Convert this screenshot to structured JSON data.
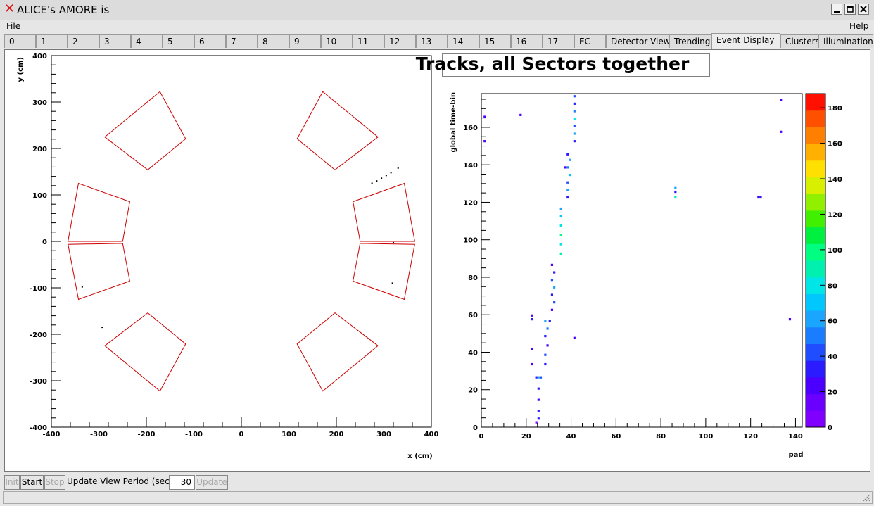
{
  "window": {
    "title": "ALICE's AMORE is"
  },
  "menu": {
    "file": "File",
    "help": "Help"
  },
  "tabs": [
    "0",
    "1",
    "2",
    "3",
    "4",
    "5",
    "6",
    "7",
    "8",
    "9",
    "10",
    "11",
    "12",
    "13",
    "14",
    "15",
    "16",
    "17",
    "EC",
    "Detector View",
    "Trending",
    "Event Display",
    "Clusters",
    "Illumination"
  ],
  "active_tab": "Event Display",
  "left_plot": {
    "xlabel": "x (cm)",
    "ylabel": "y (cm)",
    "xlim": [
      -400,
      400
    ],
    "ylim": [
      -400,
      400
    ],
    "xticks": [
      "-400",
      "-300",
      "-200",
      "-100",
      "0",
      "100",
      "200",
      "300",
      "400"
    ],
    "yticks": [
      "400",
      "300",
      "200",
      "100",
      "0",
      "-100",
      "-200",
      "-300",
      "-400"
    ]
  },
  "right_plot": {
    "title": "Tracks, all Sectors together",
    "xlabel": "pad",
    "ylabel": "global time-bin",
    "xticks": [
      "0",
      "20",
      "40",
      "60",
      "80",
      "100",
      "120",
      "140"
    ],
    "yticks": [
      "0",
      "20",
      "40",
      "60",
      "80",
      "100",
      "120",
      "140",
      "160"
    ],
    "zticks": [
      "0",
      "20",
      "40",
      "60",
      "80",
      "100",
      "120",
      "140",
      "160",
      "180"
    ]
  },
  "chart_data": [
    {
      "type": "scatter",
      "title": "",
      "xlabel": "x (cm)",
      "ylabel": "y (cm)",
      "xlim": [
        -400,
        400
      ],
      "ylim": [
        -400,
        400
      ],
      "sector_outlines_color": "#cc0000",
      "points": [
        [
          -335,
          -98
        ],
        [
          -293,
          -185
        ],
        [
          275,
          125
        ],
        [
          285,
          130
        ],
        [
          295,
          136
        ],
        [
          305,
          142
        ],
        [
          315,
          148
        ],
        [
          330,
          158
        ],
        [
          318,
          -90
        ],
        [
          320,
          -3
        ]
      ]
    },
    {
      "type": "heatmap",
      "title": "Tracks, all Sectors together",
      "xlabel": "pad",
      "ylabel": "global time-bin",
      "xlim": [
        0,
        143
      ],
      "ylim": [
        0,
        178
      ],
      "zlim": [
        0,
        188
      ],
      "cells": [
        [
          24,
          2,
          3
        ],
        [
          25,
          4,
          30
        ],
        [
          25,
          8,
          30
        ],
        [
          25,
          14,
          25
        ],
        [
          25,
          20,
          30
        ],
        [
          25,
          26,
          60
        ],
        [
          24,
          26,
          30
        ],
        [
          26,
          26,
          40
        ],
        [
          22,
          33,
          20
        ],
        [
          22,
          41,
          20
        ],
        [
          28,
          33,
          30
        ],
        [
          28,
          38,
          40
        ],
        [
          29,
          43,
          25
        ],
        [
          28,
          48,
          30
        ],
        [
          29,
          52,
          50
        ],
        [
          30,
          56,
          30
        ],
        [
          28,
          56,
          60
        ],
        [
          22,
          57,
          30
        ],
        [
          22,
          59,
          20
        ],
        [
          31,
          62,
          25
        ],
        [
          32,
          66,
          40
        ],
        [
          31,
          70,
          30
        ],
        [
          32,
          74,
          60
        ],
        [
          31,
          78,
          40
        ],
        [
          32,
          82,
          30
        ],
        [
          31,
          86,
          20
        ],
        [
          41,
          47,
          20
        ],
        [
          35,
          92,
          90
        ],
        [
          35,
          97,
          80
        ],
        [
          35,
          102,
          100
        ],
        [
          35,
          107,
          80
        ],
        [
          35,
          112,
          70
        ],
        [
          35,
          116,
          60
        ],
        [
          38,
          122,
          30
        ],
        [
          38,
          126,
          60
        ],
        [
          38,
          130,
          40
        ],
        [
          39,
          134,
          70
        ],
        [
          38,
          138,
          50
        ],
        [
          39,
          142,
          60
        ],
        [
          38,
          145,
          30
        ],
        [
          37,
          138,
          20
        ],
        [
          41,
          152,
          30
        ],
        [
          41,
          156,
          60
        ],
        [
          41,
          160,
          40
        ],
        [
          41,
          164,
          80
        ],
        [
          41,
          168,
          50
        ],
        [
          41,
          172,
          30
        ],
        [
          41,
          176,
          40
        ],
        [
          86,
          122,
          90
        ],
        [
          86,
          125,
          30
        ],
        [
          86,
          127,
          60
        ],
        [
          123,
          122,
          20
        ],
        [
          124,
          122,
          30
        ],
        [
          1,
          165,
          20
        ],
        [
          1,
          152,
          20
        ],
        [
          17,
          166,
          20
        ],
        [
          133,
          157,
          20
        ],
        [
          133,
          174,
          20
        ],
        [
          137,
          57,
          20
        ]
      ]
    }
  ],
  "toolbar": {
    "init": "Init",
    "start": "Start",
    "stop": "Stop",
    "period_label": "Update View Period (sec)",
    "period_value": "30",
    "update": "Update"
  }
}
